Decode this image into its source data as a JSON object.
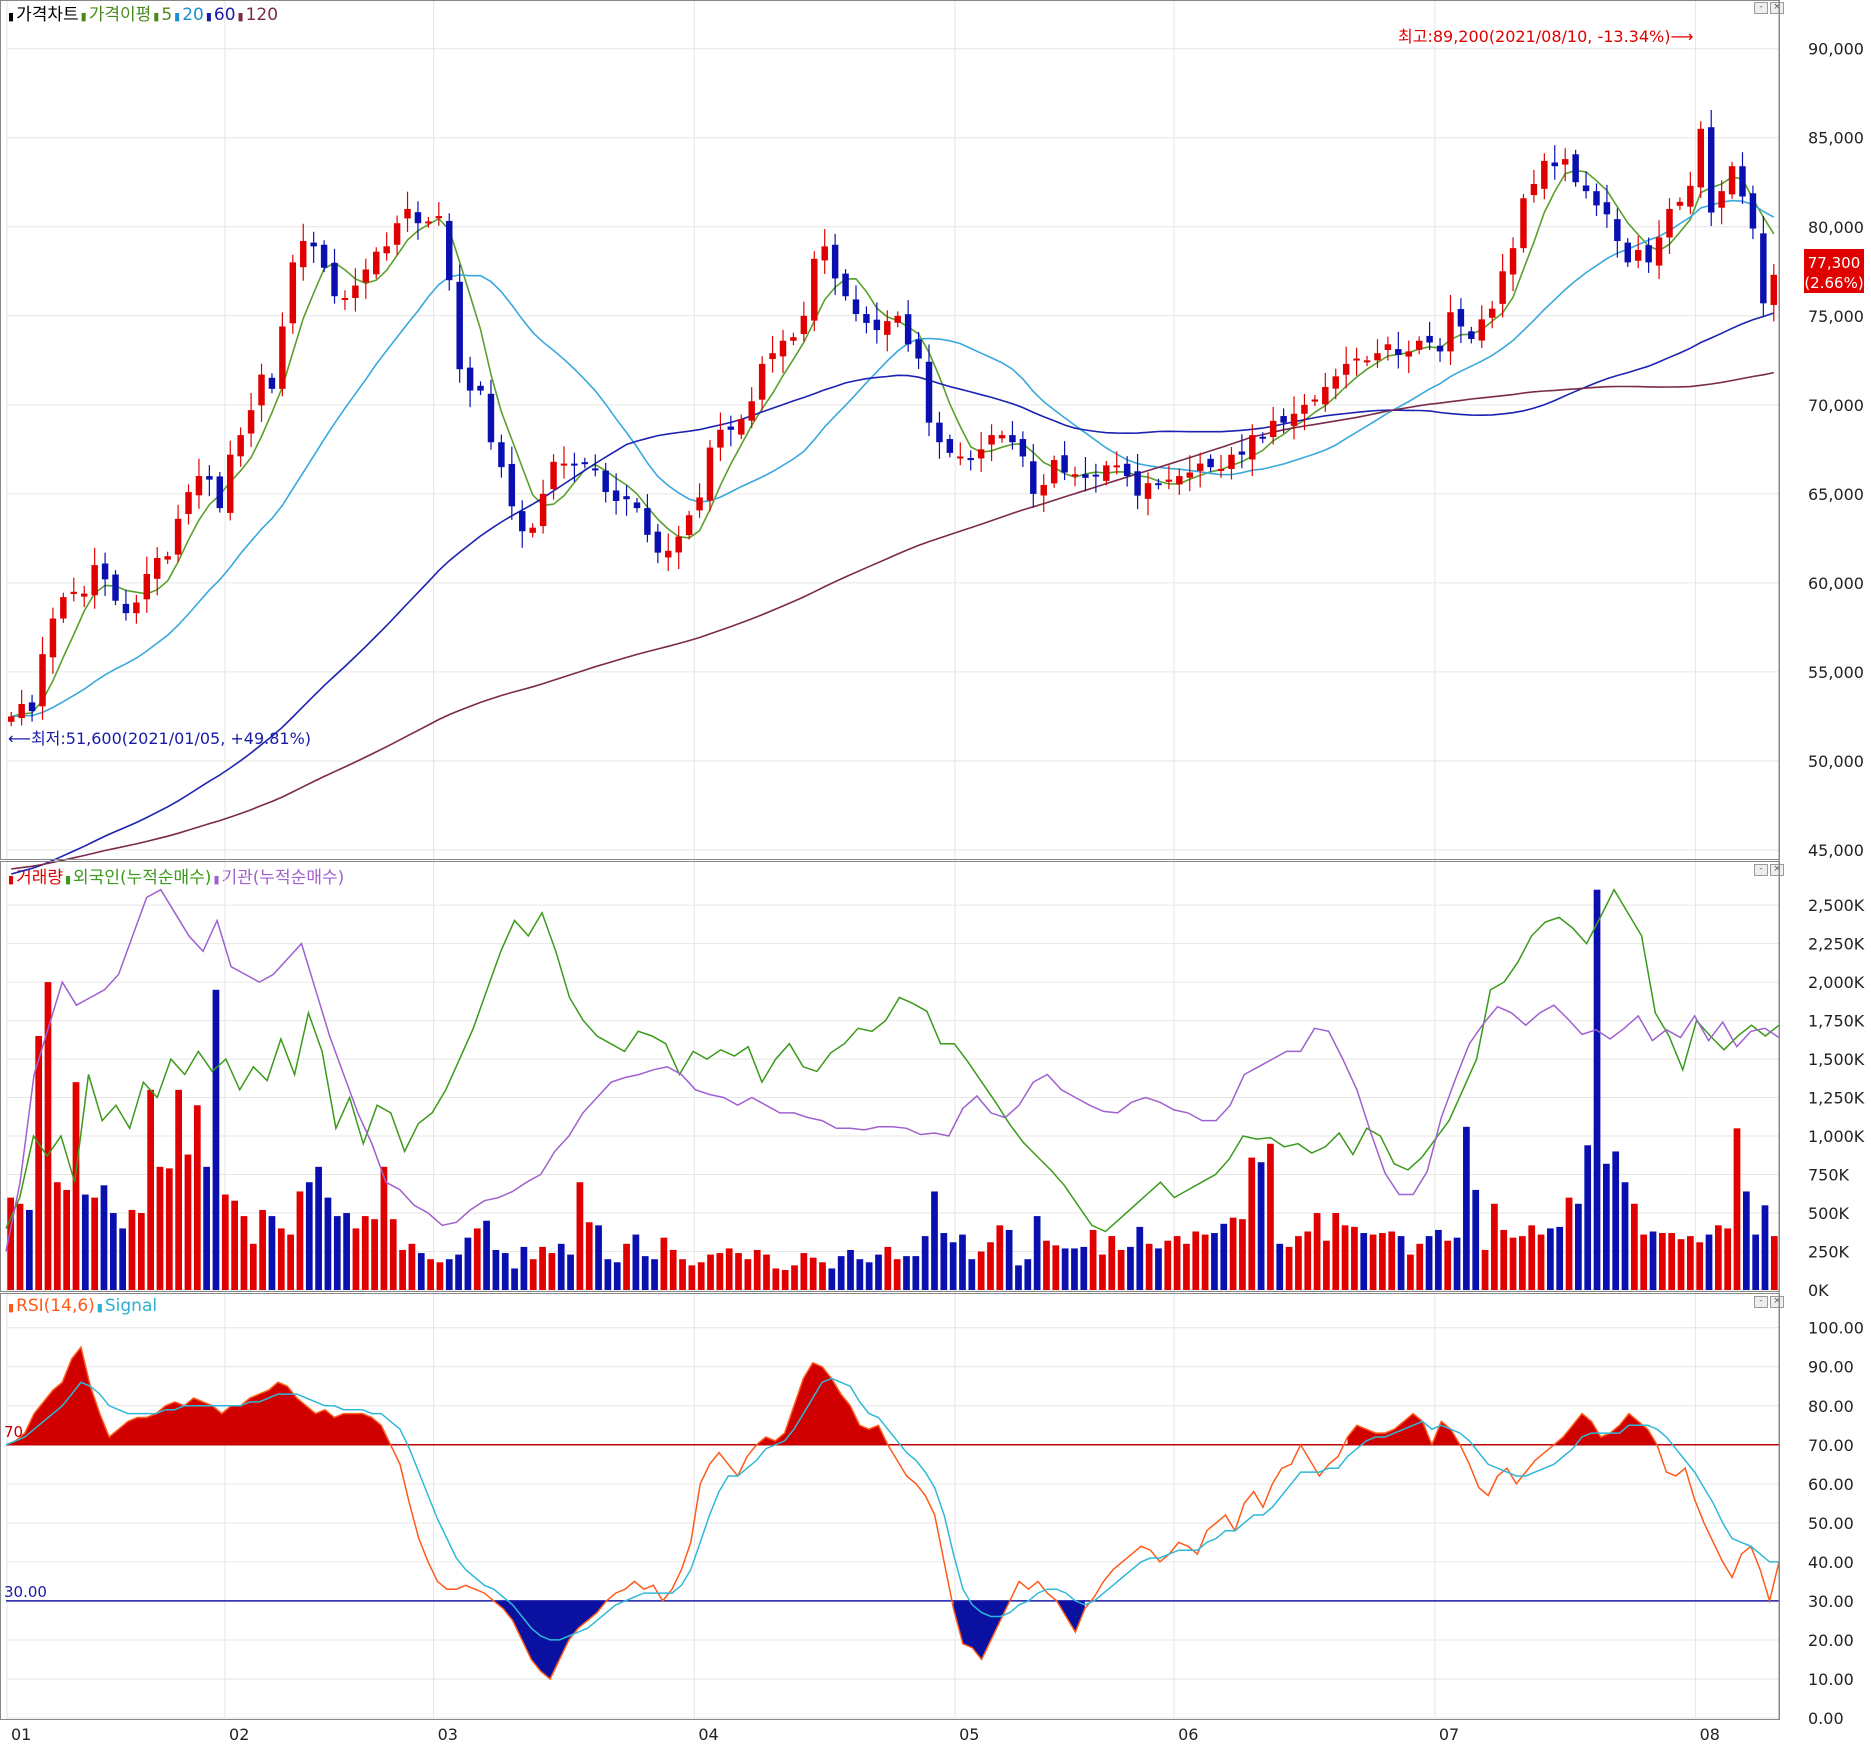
{
  "legends": {
    "price": [
      {
        "label": "가격차트",
        "color": "#000000"
      },
      {
        "label": "가격이평",
        "color": "#4a8a1c"
      },
      {
        "label": "5",
        "color": "#4a8a1c"
      },
      {
        "label": "20",
        "color": "#1a8fd0"
      },
      {
        "label": "60",
        "color": "#1a1aa8"
      },
      {
        "label": "120",
        "color": "#7a2a4a"
      }
    ],
    "volume": [
      {
        "label": "거래량",
        "color": "#e00000"
      },
      {
        "label": "외국인(누적순매수)",
        "color": "#3a9a1a"
      },
      {
        "label": "기관(누적순매수)",
        "color": "#a060d0"
      }
    ],
    "rsi": [
      {
        "label": "RSI(14,6)",
        "color": "#ff5a1a"
      },
      {
        "label": "Signal",
        "color": "#2ab0d0"
      }
    ]
  },
  "annotations": {
    "high": "최고:89,200(2021/08/10, -13.34%)⟶",
    "low": "⟵최저:51,600(2021/01/05, +49.81%)",
    "current_price": "77,300",
    "current_change": "(2.66%)",
    "rsi_level_high": "70",
    "rsi_level_low": "30.00"
  },
  "colors": {
    "up": "#e00000",
    "down": "#0a10b0",
    "ma5": "#5aa02c",
    "ma20": "#3aa8dc",
    "ma60": "#1c22b0",
    "ma120": "#7a2a4a",
    "foreign": "#3a9a1a",
    "institution": "#a060d0",
    "rsi": "#ff5a1a",
    "signal": "#30b8d8",
    "rsi_fill_high": "#d00000",
    "rsi_fill_low": "#0a10a0",
    "grid": "#e6e6e6"
  },
  "chart_data": [
    {
      "type": "candlestick",
      "panel": "price",
      "x_tick_labels": [
        "01",
        "02",
        "03",
        "04",
        "05",
        "06",
        "07",
        "08"
      ],
      "y_ticks": [
        45000,
        50000,
        55000,
        60000,
        65000,
        70000,
        75000,
        80000,
        85000,
        90000
      ],
      "y_tick_labels": [
        "45,000",
        "50,000",
        "55,000",
        "60,000",
        "65,000",
        "70,000",
        "75,000",
        "80,000",
        "85,000",
        "90,000"
      ],
      "ylim": [
        45000,
        91500
      ],
      "closes": [
        52500,
        53200,
        52800,
        56000,
        58000,
        59200,
        59500,
        59400,
        61000,
        60200,
        59000,
        58300,
        58900,
        60500,
        61400,
        61500,
        63600,
        65100,
        66000,
        65800,
        64200,
        67200,
        68300,
        69700,
        71700,
        70900,
        74400,
        78000,
        79200,
        78900,
        77700,
        76100,
        76000,
        76700,
        77600,
        78600,
        78900,
        80200,
        81000,
        80200,
        80300,
        80600,
        77000,
        72000,
        70800,
        70800,
        67900,
        66500,
        64300,
        62900,
        63100,
        65000,
        66800,
        66700,
        66600,
        66700,
        66400,
        65100,
        64600,
        64700,
        64200,
        62700,
        61700,
        61800,
        62600,
        63800,
        64800,
        67600,
        68600,
        68600,
        69200,
        70200,
        72300,
        72900,
        73600,
        73800,
        75000,
        78200,
        78900,
        77100,
        76100,
        75100,
        74600,
        74200,
        74700,
        75000,
        73400,
        72600,
        69000,
        67900,
        67300,
        67100,
        66900,
        67500,
        68300,
        68300,
        67900,
        67100,
        65000,
        65500,
        66900,
        66200,
        66100,
        65900,
        66000,
        66600,
        66600,
        66000,
        64900,
        65600,
        65500,
        65800,
        66000,
        66200,
        66700,
        66500,
        66400,
        67200,
        67200,
        68300,
        68100,
        69100,
        69000,
        69500,
        70000,
        70300,
        71000,
        71600,
        72300,
        72600,
        72500,
        72900,
        73400,
        72800,
        73000,
        73600,
        73500,
        73000,
        75200,
        74400,
        73700,
        74800,
        75400,
        77500,
        78800,
        81600,
        82400,
        83700,
        83400,
        83800,
        82500,
        82000,
        81200,
        80700,
        79200,
        78000,
        78700,
        78000,
        79400,
        81000,
        81400,
        82300,
        85500,
        80800,
        82000,
        83400,
        81700,
        79900,
        75700,
        77300
      ]
    },
    {
      "type": "bar+line",
      "panel": "volume",
      "y_ticks": [
        0,
        250,
        500,
        750,
        1000,
        1250,
        1500,
        1750,
        2000,
        2250,
        2500
      ],
      "y_tick_labels": [
        "0K",
        "250K",
        "500K",
        "750K",
        "1,000K",
        "1,250K",
        "1,500K",
        "1,750K",
        "2,000K",
        "2,250K",
        "2,500K"
      ],
      "volumes": [
        600,
        560,
        520,
        1650,
        2000,
        700,
        650,
        1350,
        620,
        600,
        680,
        500,
        400,
        520,
        500,
        1300,
        800,
        790,
        1300,
        880,
        1200,
        800,
        1950,
        620,
        580,
        480,
        300,
        520,
        480,
        400,
        360,
        640,
        700,
        800,
        600,
        480,
        500,
        400,
        480,
        460,
        800,
        460,
        260,
        300,
        240,
        200,
        180,
        200,
        230,
        340,
        400,
        450,
        260,
        240,
        140,
        280,
        200,
        280,
        240,
        300,
        230,
        700,
        440,
        420,
        200,
        180,
        300,
        360,
        220,
        200,
        340,
        260,
        200,
        160,
        180,
        230,
        240,
        270,
        240,
        200,
        260,
        230,
        140,
        130,
        160,
        240,
        210,
        180,
        140,
        220,
        260,
        200,
        180,
        230,
        280,
        200,
        220,
        220,
        350,
        640,
        370,
        310,
        360,
        200,
        250,
        310,
        420,
        390,
        160,
        200,
        480,
        320,
        290,
        270,
        270,
        280,
        390,
        230,
        350,
        260,
        280,
        410,
        300,
        270,
        320,
        350,
        300,
        380,
        360,
        370,
        430,
        470,
        460,
        860,
        830,
        950,
        300,
        280,
        350,
        380,
        500,
        320,
        500,
        420,
        410,
        370,
        360,
        370,
        380,
        350,
        230,
        300,
        350,
        390,
        320,
        340,
        1060,
        650,
        260,
        560,
        390,
        340,
        350,
        420,
        360,
        400,
        410,
        600,
        560,
        940,
        2600,
        820,
        900,
        700,
        560,
        360,
        380,
        370,
        370,
        330,
        350,
        310,
        360,
        420,
        400,
        1050,
        640,
        360,
        550,
        350
      ],
      "foreign_cum": [
        400,
        600,
        1000,
        870,
        1000,
        700,
        1400,
        1100,
        1200,
        1050,
        1350,
        1250,
        1500,
        1400,
        1550,
        1420,
        1500,
        1300,
        1450,
        1360,
        1630,
        1400,
        1800,
        1550,
        1050,
        1250,
        950,
        1200,
        1150,
        900,
        1080,
        1150,
        1300,
        1500,
        1700,
        1950,
        2200,
        2400,
        2300,
        2450,
        2200,
        1900,
        1750,
        1650,
        1600,
        1550,
        1680,
        1650,
        1600,
        1400,
        1550,
        1500,
        1560,
        1520,
        1580,
        1350,
        1500,
        1600,
        1450,
        1420,
        1540,
        1600,
        1700,
        1680,
        1750,
        1900,
        1860,
        1810,
        1600,
        1600,
        1480,
        1350,
        1220,
        1080,
        960,
        870,
        780,
        680,
        550,
        420,
        380,
        460,
        540,
        620,
        700,
        600,
        650,
        700,
        750,
        850,
        1000,
        980,
        990,
        930,
        950,
        890,
        930,
        1020,
        880,
        1050,
        1000,
        820,
        780,
        860,
        980,
        1100,
        1300,
        1500,
        1950,
        2000,
        2130,
        2300,
        2390,
        2420,
        2350,
        2250,
        2420,
        2600,
        2450,
        2300,
        1800,
        1650,
        1430,
        1750,
        1650,
        1560,
        1650,
        1720,
        1650,
        1720
      ],
      "institution_cum": [
        250,
        700,
        1400,
        1700,
        2000,
        1850,
        1900,
        1950,
        2050,
        2300,
        2550,
        2600,
        2450,
        2300,
        2200,
        2400,
        2100,
        2050,
        2000,
        2050,
        2150,
        2250,
        1950,
        1650,
        1400,
        1150,
        950,
        700,
        650,
        550,
        500,
        420,
        440,
        520,
        580,
        600,
        640,
        700,
        750,
        900,
        1000,
        1150,
        1250,
        1350,
        1380,
        1400,
        1430,
        1450,
        1400,
        1300,
        1270,
        1250,
        1200,
        1250,
        1200,
        1150,
        1150,
        1120,
        1100,
        1050,
        1050,
        1040,
        1060,
        1060,
        1050,
        1010,
        1020,
        1000,
        1180,
        1260,
        1150,
        1120,
        1200,
        1350,
        1400,
        1300,
        1250,
        1200,
        1160,
        1150,
        1220,
        1250,
        1220,
        1170,
        1150,
        1100,
        1100,
        1200,
        1400,
        1450,
        1500,
        1550,
        1550,
        1700,
        1680,
        1500,
        1300,
        1020,
        760,
        620,
        620,
        770,
        1120,
        1370,
        1600,
        1730,
        1840,
        1800,
        1720,
        1800,
        1850,
        1760,
        1660,
        1690,
        1630,
        1700,
        1780,
        1620,
        1690,
        1640,
        1780,
        1620,
        1740,
        1580,
        1680,
        1700,
        1640
      ]
    },
    {
      "type": "line",
      "panel": "rsi",
      "y_ticks": [
        0,
        10,
        20,
        30,
        40,
        50,
        60,
        70,
        80,
        90,
        100
      ],
      "y_tick_labels": [
        "0.00",
        "10.00",
        "20.00",
        "30.00",
        "40.00",
        "50.00",
        "60.00",
        "70.00",
        "80.00",
        "90.00",
        "100.00"
      ],
      "ylim": [
        0,
        103
      ],
      "rsi": [
        70,
        71,
        73,
        78,
        81,
        84,
        86,
        92,
        95,
        85,
        78,
        72,
        74,
        76,
        77,
        77,
        78,
        80,
        81,
        80,
        82,
        81,
        80,
        78,
        80,
        80,
        82,
        83,
        84,
        86,
        85,
        82,
        80,
        78,
        79,
        77,
        78,
        78,
        78,
        77,
        75,
        70,
        65,
        55,
        46,
        40,
        35,
        33,
        33,
        34,
        33,
        32,
        30,
        28,
        25,
        20,
        15,
        12,
        10,
        15,
        20,
        23,
        25,
        27,
        30,
        32,
        33,
        35,
        33,
        34,
        30,
        33,
        38,
        45,
        60,
        65,
        68,
        65,
        62,
        67,
        70,
        72,
        71,
        73,
        80,
        87,
        91,
        90,
        87,
        83,
        80,
        75,
        74,
        75,
        70,
        66,
        62,
        60,
        57,
        52,
        40,
        28,
        19,
        18,
        15,
        20,
        25,
        30,
        35,
        33,
        35,
        32,
        30,
        26,
        22,
        28,
        31,
        35,
        38,
        40,
        42,
        44,
        43,
        40,
        42,
        45,
        44,
        42,
        48,
        50,
        52,
        48,
        55,
        58,
        54,
        60,
        64,
        65,
        70,
        66,
        62,
        65,
        67,
        72,
        75,
        74,
        73,
        73,
        74,
        76,
        78,
        76,
        70,
        76,
        74,
        70,
        65,
        59,
        57,
        62,
        64,
        60,
        63,
        66,
        68,
        70,
        72,
        75,
        78,
        76,
        72,
        73,
        75,
        78,
        76,
        74,
        70,
        63,
        62,
        64,
        56,
        50,
        45,
        40,
        36,
        42,
        44,
        38,
        30,
        40
      ],
      "signal": [
        70,
        71,
        72,
        74,
        76,
        78,
        80,
        83,
        86,
        85,
        83,
        80,
        79,
        78,
        78,
        78,
        78,
        79,
        79,
        80,
        80,
        80,
        80,
        80,
        80,
        80,
        81,
        81,
        82,
        83,
        83,
        83,
        82,
        81,
        80,
        80,
        79,
        79,
        79,
        78,
        78,
        76,
        74,
        69,
        63,
        57,
        51,
        46,
        41,
        38,
        36,
        34,
        33,
        31,
        29,
        26,
        23,
        21,
        20,
        20,
        21,
        22,
        23,
        25,
        27,
        29,
        30,
        31,
        32,
        32,
        32,
        32,
        34,
        38,
        45,
        52,
        58,
        62,
        62,
        64,
        66,
        69,
        70,
        71,
        74,
        78,
        82,
        86,
        87,
        86,
        85,
        81,
        78,
        77,
        74,
        71,
        68,
        66,
        63,
        59,
        52,
        42,
        33,
        29,
        27,
        26,
        26,
        27,
        29,
        30,
        32,
        33,
        33,
        32,
        30,
        29,
        30,
        32,
        34,
        36,
        38,
        40,
        41,
        41,
        42,
        43,
        43,
        43,
        45,
        46,
        48,
        48,
        50,
        52,
        52,
        54,
        57,
        60,
        63,
        63,
        63,
        64,
        64,
        67,
        69,
        71,
        72,
        72,
        73,
        74,
        75,
        76,
        74,
        75,
        74,
        73,
        71,
        68,
        65,
        64,
        63,
        62,
        62,
        63,
        64,
        65,
        67,
        69,
        72,
        73,
        73,
        73,
        73,
        75,
        75,
        75,
        74,
        72,
        69,
        66,
        63,
        59,
        55,
        50,
        46,
        45,
        44,
        42,
        40,
        40
      ]
    }
  ]
}
